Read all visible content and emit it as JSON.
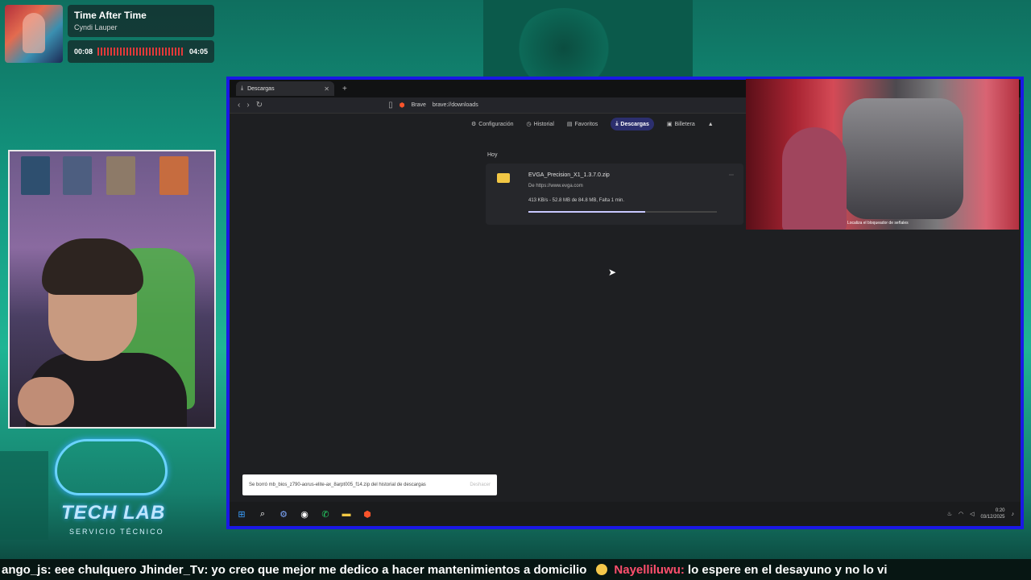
{
  "music": {
    "title": "Time After Time",
    "artist": "Cyndi Lauper",
    "elapsed": "00:08",
    "duration": "04:05",
    "progress_fraction": 0.03
  },
  "logo": {
    "word": "TECH LAB",
    "subtitle": "SERVICIO TÉCNICO"
  },
  "browser": {
    "tab_title": "Descargas",
    "new_tab_symbol": "+",
    "brand": "Brave",
    "url": "brave://downloads",
    "settings_nav": [
      "Configuración",
      "Historial",
      "Favoritos",
      "Descargas",
      "Billetera"
    ],
    "active_nav": "Descargas",
    "section_label": "Hoy",
    "download": {
      "file_name": "EVGA_Precision_X1_1.3.7.0.zip",
      "source": "De https://www.evga.com",
      "status": "413 KB/s - 52.8 MB de 84.8 MB, Falta 1 min.",
      "progress_fraction": 0.62
    },
    "toast": {
      "message": "Se borró mb_bios_z790-aorus-elite-ax_8arpt005_f14.zip del historial de descargas",
      "button": "Deshacer"
    },
    "clock": {
      "time": "0:20",
      "date": "03/12/2025"
    }
  },
  "game": {
    "subtitle": "Localiza el bloqueador de señales"
  },
  "chat": [
    {
      "user": "ango_js:",
      "message": "eee chulquero"
    },
    {
      "user": "Jhinder_Tv:",
      "message": "yo creo que mejor me dedico a hacer mantenimientos a domicilio"
    },
    {
      "user": "Nayelliluwu:",
      "message": "lo espere en el desayuno y no lo vi"
    }
  ]
}
